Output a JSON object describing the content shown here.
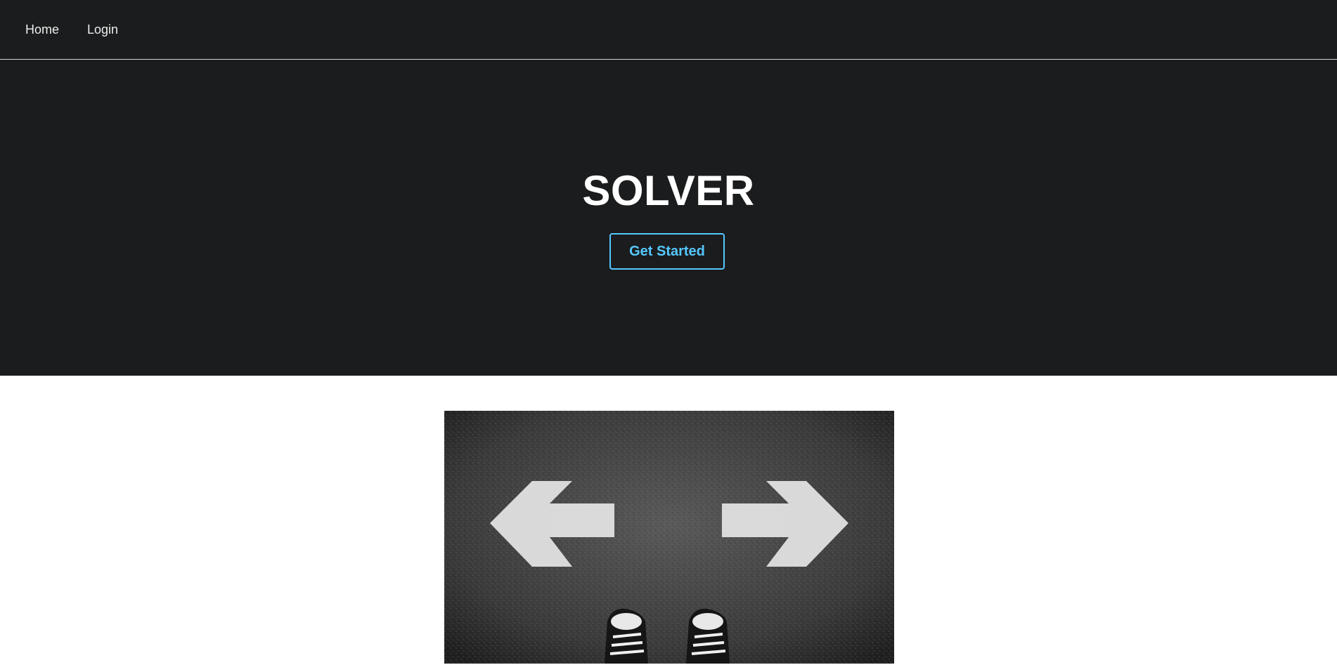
{
  "nav": {
    "items": [
      {
        "label": "Home"
      },
      {
        "label": "Login"
      }
    ]
  },
  "hero": {
    "title": "SOLVER",
    "cta_label": "Get Started"
  },
  "image": {
    "subject": "asphalt road with left and right arrows and sneakers"
  },
  "colors": {
    "nav_bg": "#1b1c1d",
    "accent": "#54c8ff",
    "page_bg": "#ffffff"
  }
}
